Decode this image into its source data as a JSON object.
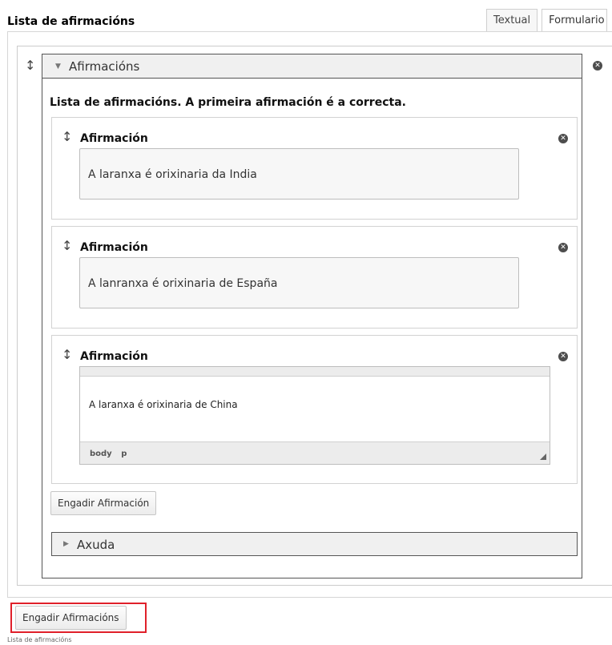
{
  "section": {
    "title": "Lista de afirmacións"
  },
  "tabs": [
    {
      "label": "Textual"
    },
    {
      "label": "Formulario"
    }
  ],
  "group": {
    "legend": "Afirmacións",
    "description": "Lista de afirmacións. A primeira afirmación é a correcta.",
    "items": [
      {
        "label": "Afirmación",
        "value": "A laranxa é orixinaria da India"
      },
      {
        "label": "Afirmación",
        "value": "A lanranxa é orixinaria de España"
      },
      {
        "label": "Afirmación",
        "value": "A laranxa é orixinaria de China"
      }
    ],
    "editor_status": [
      "body",
      "p"
    ],
    "add_item_label": "Engadir Afirmación",
    "help_label": "Axuda"
  },
  "add_group_label": "Engadir Afirmacións",
  "footer_label": "Lista de afirmacións",
  "icons": {
    "drag": "vertical-arrows",
    "remove": "circle-x",
    "expanded": "triangle-down",
    "collapsed": "triangle-right"
  },
  "colors": {
    "highlight": "#e0202a",
    "legend_bg": "#f0f0f0"
  }
}
